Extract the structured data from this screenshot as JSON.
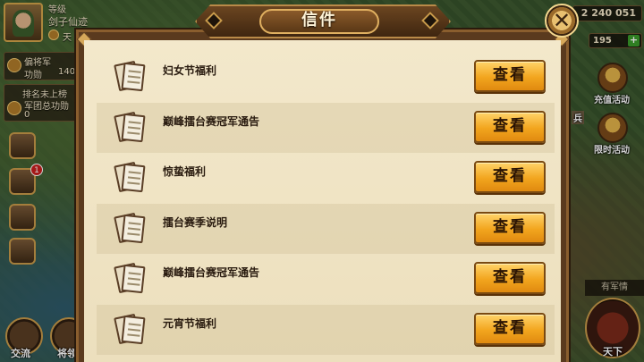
{
  "hud": {
    "level_label": "等级",
    "player_name": "剑子仙迹",
    "title_prefix": "天",
    "rank_title": "偏将军",
    "merit_label": "功勋",
    "merit_value": "140",
    "rank_status": "排名未上榜",
    "legion_label": "军团总功勋",
    "legion_value": "0",
    "mail_badge": "1",
    "chat_label": "交流",
    "general_label": "将领"
  },
  "right_hud": {
    "gold": "2 240 051",
    "gems": "195",
    "gem_add": "+",
    "recharge_label": "充值活动",
    "limited_label": "限时活动",
    "soldier_tag": "兵",
    "news_label": "有军情",
    "world_label": "天下"
  },
  "dialog": {
    "title": "信件",
    "close_symbol": "✕",
    "view_label": "查看",
    "mails": [
      {
        "title": "妇女节福利"
      },
      {
        "title": "巅峰擂台赛冠军通告"
      },
      {
        "title": "惊蛰福利"
      },
      {
        "title": "擂台赛季说明"
      },
      {
        "title": "巅峰擂台赛冠军通告"
      },
      {
        "title": "元宵节福利"
      }
    ]
  },
  "colors": {
    "paper": "#f3e8cb",
    "button": "#f2a51e",
    "frame": "#5a3a1e"
  }
}
